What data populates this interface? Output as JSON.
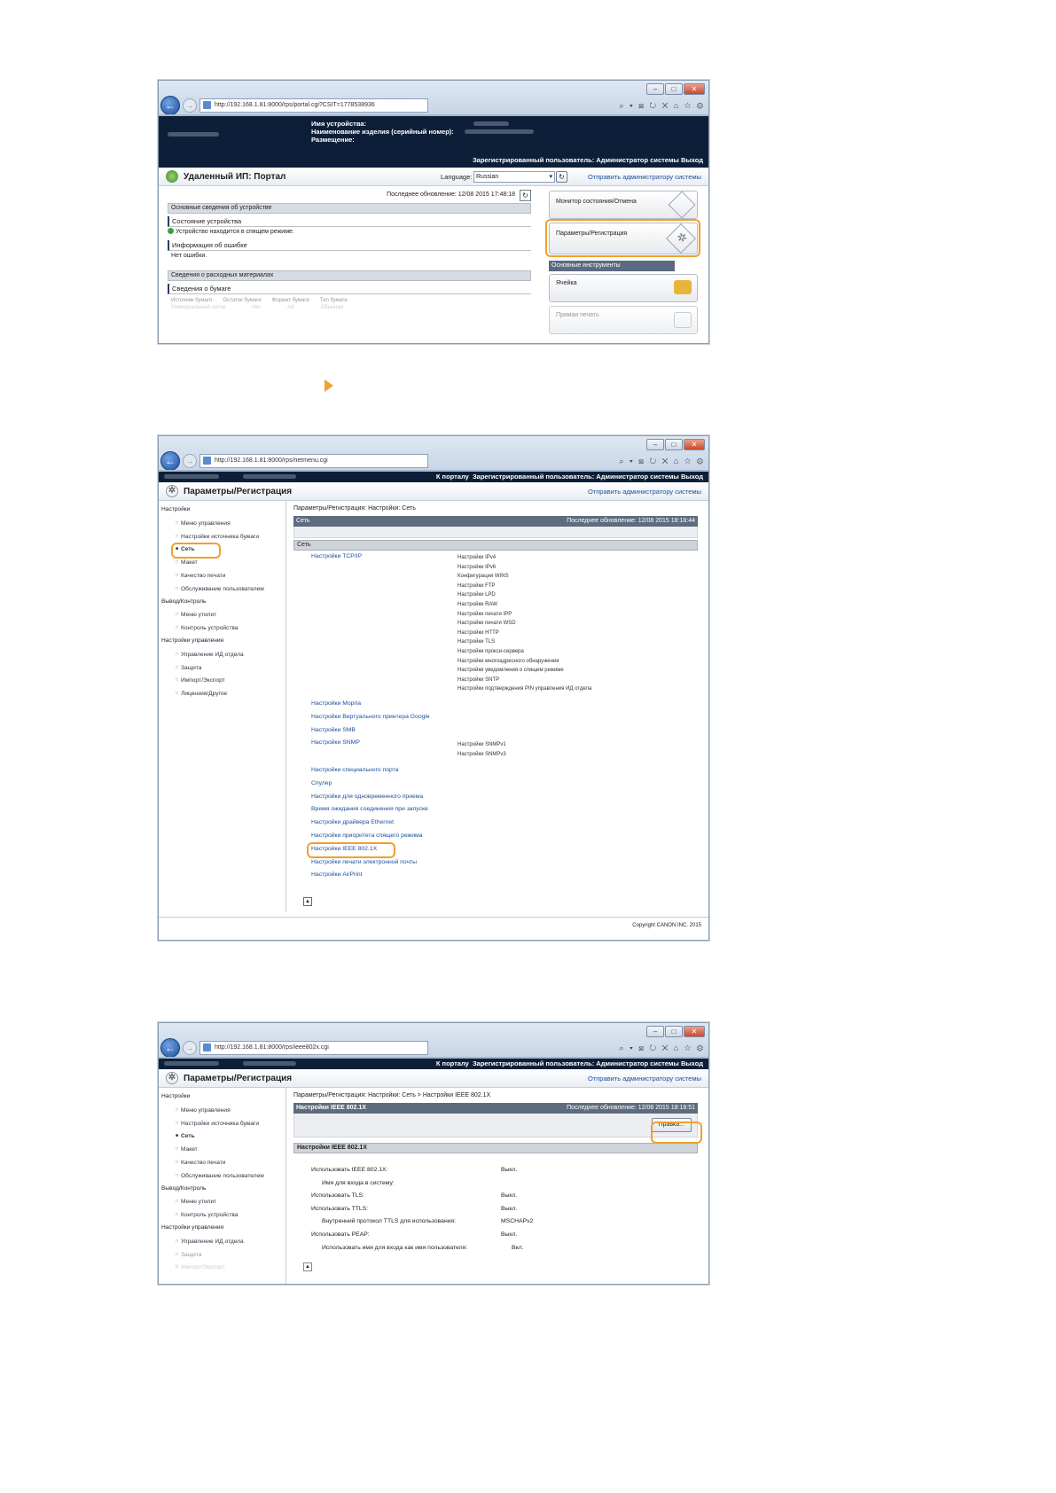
{
  "browser": {
    "url1": "http://192.168.1.81:8000/rps/portal.cgi?CSIT=1778538936",
    "url2": "http://192.168.1.81:8000/rps/netmenu.cgi",
    "url3": "http://192.168.1.81:8000/rps/ieee802x.cgi",
    "url_host": "192.168.1.81",
    "tools": "⌕ ▾ ⊠ ↻ ✕   ⌂ ☆ ⚙"
  },
  "shot1": {
    "device_name_label": "Имя устройства:",
    "product_name_label": "Наименование изделия (серийный номер):",
    "location_label": "Размещение:",
    "login_status": "Зарегистрированный пользователь: Администратор системы",
    "logout": "Выход",
    "portal_title": "Удаленный ИП: Портал",
    "language_label": "Language:",
    "language_value": "Russian",
    "mail_admin": "Отправить администратору системы",
    "last_update": "Последнее обновление: 12/08 2015 17:48:18",
    "basic_info": "Основные сведения об устройстве",
    "device_status": "Состояние устройства",
    "sleep_mode": "Устройство находится в спящем режиме.",
    "error_info": "Информация об ошибке",
    "no_errors": "Нет ошибки.",
    "consumables": "Сведения о расходных материалах",
    "paper_info": "Сведения о бумаге",
    "col_source": "Источник бумаги",
    "col_remain": "Остаток бумаги",
    "col_size": "Формат бумаги",
    "col_type": "Тип бумаги",
    "row_source": "Универсальный лоток",
    "row_remain": "Нет",
    "row_size": "A4",
    "row_type": "Обычная",
    "status_monitor": "Монитор состояния/Отмена",
    "settings_reg": "Параметры/Регистрация",
    "basic_tools": "Основные инструменты",
    "mailbox": "Ячейка",
    "direct_print": "Прямая печать"
  },
  "shot2": {
    "to_portal": "К порталу",
    "login_status": "Зарегистрированный пользователь: Администратор системы",
    "logout": "Выход",
    "title": "Параметры/Регистрация",
    "mail_admin": "Отправить администратору системы",
    "breadcrumb": "Параметры/Регистрация: Настройки: Сеть",
    "section": "Сеть",
    "last_update": "Последнее обновление: 12/08 2015 18:18:44",
    "subsection": "Сеть",
    "copyright": "Copyright CANON INC. 2015"
  },
  "nav": {
    "settings": "Настройки",
    "control_menu": "Меню управления",
    "paper_source": "Настройки источника бумаги",
    "network": "Сеть",
    "layout": "Макет",
    "print_quality": "Качество печати",
    "user_maint": "Обслуживание пользователем",
    "output_control": "Вывод/Контроль",
    "utility_menu": "Меню утилит",
    "device_control": "Контроль устройства",
    "mgmt_settings": "Настройки управления",
    "dept_id": "Управление ИД отдела",
    "security": "Защита",
    "import_export": "Импорт/Экспорт",
    "license_other": "Лицензия/Другое"
  },
  "network_links": {
    "tcpip": "Настройки TCP/IP",
    "mopria": "Настройки Mopria",
    "google": "Настройки Виртуального принтера Google",
    "smb": "Настройки SMB",
    "snmp": "Настройки SNMP",
    "dedicated_port": "Настройки специального порта",
    "spooler": "Спулер",
    "simul": "Настройки для одновременного приема",
    "conn_wait": "Время ожидания соединения при запуске",
    "ethernet": "Настройки драйвера Ethernet",
    "sleep_priority": "Настройки приоритета спящего режима",
    "ieee": "Настройки IEEE 802.1X",
    "email_print": "Настройки печати электронной почты",
    "airprint": "Настройки AirPrint"
  },
  "tcpip_items": [
    "Настройки IPv4",
    "Настройки IPv6",
    "Конфигурация WINS",
    "Настройки FTP",
    "Настройки LPD",
    "Настройки RAW",
    "Настройки печати IPP",
    "Настройки печати WSD",
    "Настройки HTTP",
    "Настройки TLS",
    "Настройки прокси-сервера",
    "Настройки многоадресного обнаружения",
    "Настройки уведомления о спящем режиме",
    "Настройки SNTP",
    "Настройки подтверждения PIN управления ИД отдела"
  ],
  "snmp_items": [
    "Настройки SNMPv1",
    "Настройки SNMPv3"
  ],
  "shot3": {
    "breadcrumb": "Параметры/Регистрация: Настройки: Сеть > Настройки IEEE 802.1X",
    "section": "Настройки IEEE 802.1X",
    "last_update": "Последнее обновление: 12/08 2015 18:18:51",
    "edit_button": "Правка...",
    "subsection": "Настройки IEEE 802.1X",
    "rows": [
      {
        "label": "Использовать IEEE 802.1X:",
        "value": "Выкл."
      },
      {
        "label": "Имя для входа в систему:",
        "value": ""
      },
      {
        "label": "Использовать TLS:",
        "value": "Выкл."
      },
      {
        "label": "Использовать TTLS:",
        "value": "Выкл."
      },
      {
        "label": "Внутренний протокол TTLS для использования:",
        "value": "MSCHAPv2"
      },
      {
        "label": "Использовать PEAP:",
        "value": "Выкл."
      },
      {
        "label": "Использовать имя для входа как имя пользователя:",
        "value": "Вкл."
      }
    ]
  },
  "colors": {
    "highlight": "#f0a02c",
    "header_dark": "#0d1f38",
    "link": "#1a4fa0",
    "status_green": "#3aa33a"
  }
}
